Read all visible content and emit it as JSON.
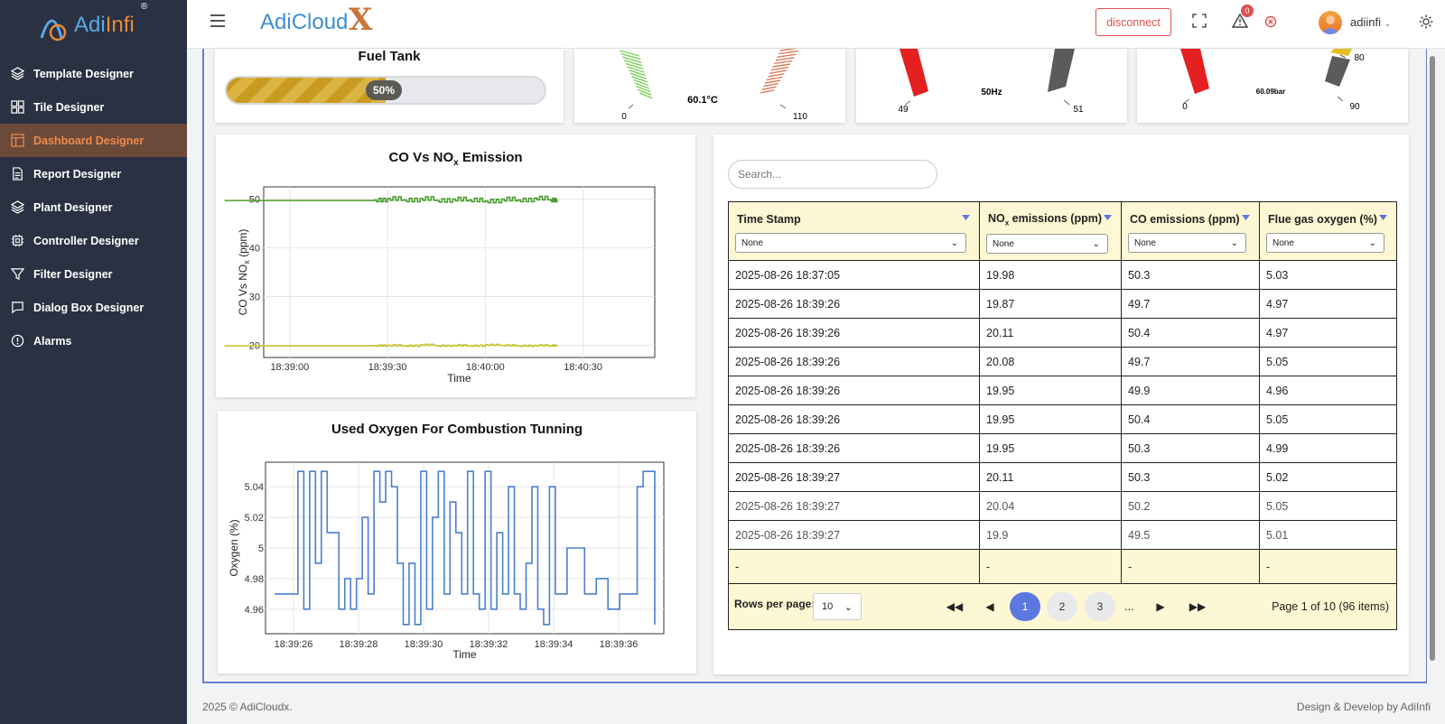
{
  "sidebar": {
    "logo_text": "Adi",
    "logo_text2": "Infi",
    "logo_reg": "®",
    "items": [
      {
        "label": "Template Designer",
        "icon": "layers-icon"
      },
      {
        "label": "Tile Designer",
        "icon": "grid-icon"
      },
      {
        "label": "Dashboard Designer",
        "icon": "dashboard-icon",
        "active": true
      },
      {
        "label": "Report Designer",
        "icon": "document-icon"
      },
      {
        "label": "Plant Designer",
        "icon": "layers-icon"
      },
      {
        "label": "Controller Designer",
        "icon": "chip-icon"
      },
      {
        "label": "Filter Designer",
        "icon": "filter-icon"
      },
      {
        "label": "Dialog Box Designer",
        "icon": "chat-icon"
      },
      {
        "label": "Alarms",
        "icon": "alert-circle-icon"
      }
    ]
  },
  "header": {
    "brand": "AdiCloud",
    "brand_x": "X",
    "disconnect_label": "disconnect",
    "alert_count": "0",
    "username": "adiinfi"
  },
  "fuel_tank": {
    "title": "Fuel Tank",
    "level_percent": 50,
    "level_label": "50%"
  },
  "gauges": [
    {
      "value_label": "60.1°C",
      "min": "0",
      "max": "110"
    },
    {
      "value_label": "50Hz",
      "min": "49",
      "max": "51"
    },
    {
      "value_label": "60.09bar",
      "min": "0",
      "max": "90",
      "tick": "80"
    }
  ],
  "chart_co": {
    "title": "CO Vs NO",
    "title_sub": "x",
    "title_suffix": " Emission",
    "chart_data": {
      "type": "line",
      "x": [
        "18:38:40",
        "18:39:00",
        "18:39:26",
        "18:39:30",
        "18:39:35",
        "18:39:40",
        "18:39:45",
        "18:39:50",
        "18:39:55",
        "18:40:00",
        "18:40:05",
        "18:40:10",
        "18:40:15",
        "18:40:20",
        "18:40:22"
      ],
      "series": [
        {
          "values": [
            49.7,
            49.7,
            49.8,
            50.1,
            49.8,
            50.1,
            49.7,
            50.0,
            49.8,
            49.6,
            50.0,
            49.8,
            50.2,
            49.8,
            50.0
          ],
          "color": "#4a9e2c"
        },
        {
          "values": [
            19.9,
            19.9,
            19.95,
            20.0,
            19.9,
            20.1,
            19.9,
            20.0,
            19.9,
            20.1,
            20.0,
            19.9,
            20.0,
            19.95,
            20.0
          ],
          "color": "#c9c233"
        }
      ],
      "ylabel": "CO Vs NO",
      "ylabel_sub": "x",
      "ylabel_suffix": " (ppm)",
      "xlabel": "Time",
      "ylim": [
        17.5,
        52.5
      ],
      "yticks": [
        "20",
        "30",
        "40",
        "50"
      ],
      "xticks": [
        "18:39:00",
        "18:39:30",
        "18:40:00",
        "18:40:30"
      ],
      "grid": true
    }
  },
  "chart_oxygen": {
    "title": "Used Oxygen For Combustion Tunning",
    "chart_data": {
      "type": "line",
      "x_seconds_labels": [
        "18:39:26",
        "18:39:28",
        "18:39:30",
        "18:39:32",
        "18:39:34",
        "18:39:36"
      ],
      "series": [
        {
          "values": [
            4.97,
            4.97,
            4.97,
            4.97,
            5.05,
            4.96,
            5.05,
            4.99,
            5.05,
            5.01,
            5.01,
            4.96,
            4.98,
            4.96,
            4.98,
            5.02,
            4.97,
            5.05,
            5.03,
            5.05,
            5.04,
            4.99,
            4.95,
            4.99,
            4.95,
            5.05,
            4.96,
            5.02,
            5.05,
            4.97,
            5.03,
            5.01,
            4.97,
            5.05,
            4.97,
            4.96,
            5.05,
            4.96,
            5.01,
            4.97,
            5.04,
            4.97,
            4.96,
            4.99,
            5.04,
            4.96,
            4.95,
            5.04,
            4.97,
            4.97,
            5.0,
            5.0,
            5.0,
            4.97,
            4.97,
            4.98,
            4.98,
            4.96,
            4.96,
            4.97,
            4.97,
            4.97,
            5.04,
            5.05,
            5.05,
            4.95
          ],
          "color": "#4a7fd0"
        }
      ],
      "ylabel": "Oxygen (%)",
      "xlabel": "Time",
      "ylim": [
        4.944,
        5.056
      ],
      "yticks": [
        "4.96",
        "4.98",
        "5",
        "5.02",
        "5.04"
      ],
      "grid": true
    }
  },
  "table": {
    "search_placeholder": "Search...",
    "columns": [
      {
        "label": "Time Stamp",
        "filter": "None"
      },
      {
        "label": "NO",
        "sub": "x",
        "suffix": " emissions (ppm)",
        "filter": "None"
      },
      {
        "label": "CO emissions (ppm)",
        "filter": "None"
      },
      {
        "label": "Flue gas oxygen (%)",
        "filter": "None"
      }
    ],
    "rows": [
      [
        "2025-08-26 18:37:05",
        "19.98",
        "50.3",
        "5.03"
      ],
      [
        "2025-08-26 18:39:26",
        "19.87",
        "49.7",
        "4.97"
      ],
      [
        "2025-08-26 18:39:26",
        "20.11",
        "50.4",
        "4.97"
      ],
      [
        "2025-08-26 18:39:26",
        "20.08",
        "49.7",
        "5.05"
      ],
      [
        "2025-08-26 18:39:26",
        "19.95",
        "49.9",
        "4.96"
      ],
      [
        "2025-08-26 18:39:26",
        "19.95",
        "50.4",
        "5.05"
      ],
      [
        "2025-08-26 18:39:26",
        "19.95",
        "50.3",
        "4.99"
      ],
      [
        "2025-08-26 18:39:27",
        "20.11",
        "50.3",
        "5.02"
      ],
      [
        "2025-08-26 18:39:27",
        "20.04",
        "50.2",
        "5.05"
      ],
      [
        "2025-08-26 18:39:27",
        "19.9",
        "49.5",
        "5.01"
      ]
    ],
    "footer": [
      "-",
      "-",
      "-",
      "-"
    ],
    "rows_per_page_label": "Rows per page:",
    "rows_per_page": "10",
    "pages": [
      "1",
      "2",
      "3"
    ],
    "ellipsis": "...",
    "page_info": "Page 1 of 10 (96 items)"
  },
  "footer": {
    "copyright": "2025 © AdiCloudx.",
    "credit": "Design & Develop by AdiInfi"
  },
  "colors": {
    "sidebar_bg": "#2a3142",
    "active_nav": "#f08a4b",
    "pager_current": "#5b77e0"
  }
}
